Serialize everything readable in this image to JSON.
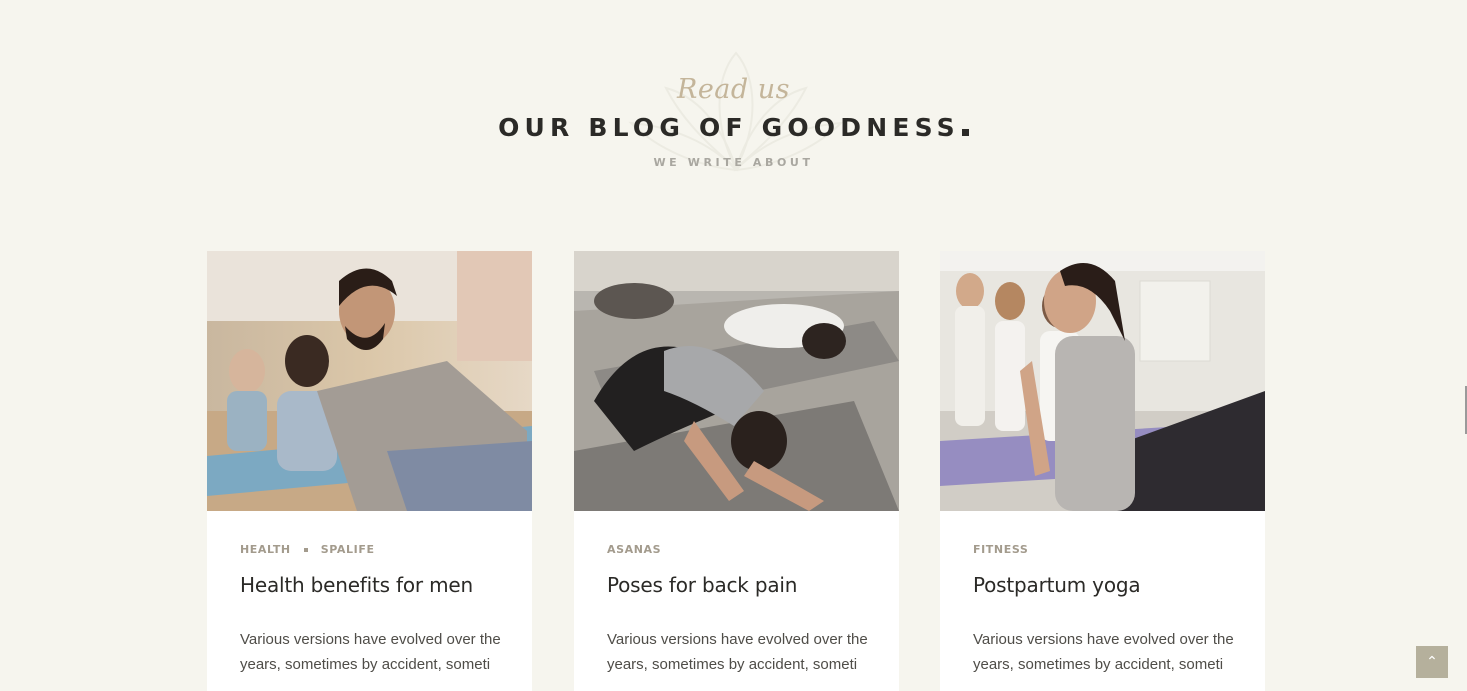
{
  "header": {
    "script": "Read us",
    "title": "OUR BLOG OF GOODNESS",
    "subtitle": "WE WRITE ABOUT"
  },
  "posts": [
    {
      "categories": [
        "HEALTH",
        "SPALIFE"
      ],
      "title": "Health benefits for men",
      "excerpt": "Various versions have evolved over the years, sometimes by accident, someti"
    },
    {
      "categories": [
        "ASANAS"
      ],
      "title": "Poses for back pain",
      "excerpt": "Various versions have evolved over the years, sometimes by accident, someti"
    },
    {
      "categories": [
        "FITNESS"
      ],
      "title": "Postpartum yoga",
      "excerpt": "Various versions have evolved over the years, sometimes by accident, someti"
    }
  ],
  "scroll_top": {
    "icon": "chevron-up-icon",
    "glyph": "⌃"
  },
  "colors": {
    "background": "#f6f5ee",
    "accent": "#c4b59a",
    "text": "#2b2a27",
    "meta": "#a39b8d"
  }
}
